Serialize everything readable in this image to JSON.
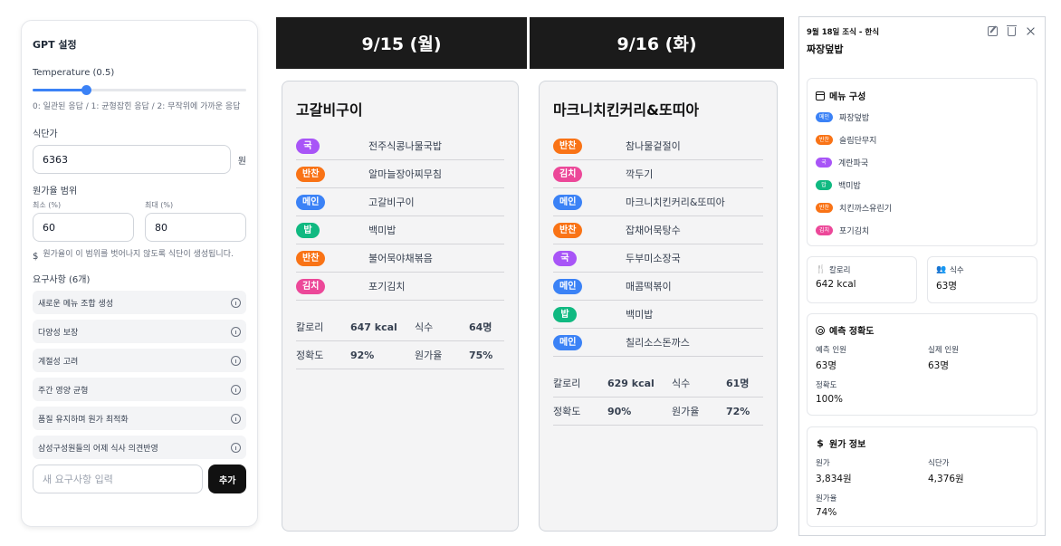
{
  "colors": {
    "rice": "#10b981",
    "soup": "#a855f7",
    "side": "#f97316",
    "main": "#3b82f6",
    "kimchi": "#ec4899"
  },
  "settings": {
    "title": "GPT 설정",
    "temperature_label": "Temperature (0.5)",
    "temperature_value": 0.5,
    "temperature_hint": "0: 일관된 응답 / 1: 균형잡힌 응답 / 2: 무작위에 가까운 응답",
    "meal_price_label": "식단가",
    "meal_price_value": "6363",
    "meal_price_unit": "원",
    "cost_range_label": "원가율 범위",
    "min_label": "최소 (%)",
    "min_value": "60",
    "max_label": "최대 (%)",
    "max_value": "80",
    "cost_note": "원가율이 이 범위를 벗어나지 않도록 식단이 생성됩니다.",
    "requirements_label": "요구사항 (6개)",
    "requirements": [
      "새로운 메뉴 조합 생성",
      "다양성 보장",
      "계절성 고려",
      "주간 영양 균형",
      "품질 유지하며 원가 최적화",
      "삼성구성원들의 어제 식사 의견반영"
    ],
    "new_requirement_placeholder": "새 요구사항 입력",
    "add_button": "추가"
  },
  "days": [
    {
      "header": "9/15 (월)",
      "title": "고갈비구이",
      "dishes": [
        {
          "tag": "국",
          "type": "soup",
          "name": "전주식콩나물국밥"
        },
        {
          "tag": "반찬",
          "type": "side",
          "name": "알마늘장아찌무침"
        },
        {
          "tag": "메인",
          "type": "main",
          "name": "고갈비구이"
        },
        {
          "tag": "밥",
          "type": "rice",
          "name": "백미밥"
        },
        {
          "tag": "반찬",
          "type": "side",
          "name": "불어묵야채볶음"
        },
        {
          "tag": "김치",
          "type": "kimchi",
          "name": "포기김치"
        }
      ],
      "stats": {
        "calorie_label": "칼로리",
        "calorie": "647 kcal",
        "count_label": "식수",
        "count": "64명",
        "accuracy_label": "정확도",
        "accuracy": "92%",
        "cost_label": "원가율",
        "cost": "75%"
      }
    },
    {
      "header": "9/16 (화)",
      "title": "마크니치킨커리&또띠아",
      "dishes": [
        {
          "tag": "반찬",
          "type": "side",
          "name": "참나물겉절이"
        },
        {
          "tag": "김치",
          "type": "kimchi",
          "name": "깍두기"
        },
        {
          "tag": "메인",
          "type": "main",
          "name": "마크니치킨커리&또띠아"
        },
        {
          "tag": "반찬",
          "type": "side",
          "name": "잡채어묵탕수"
        },
        {
          "tag": "국",
          "type": "soup",
          "name": "두부미소장국"
        },
        {
          "tag": "메인",
          "type": "main",
          "name": "매콤떡볶이"
        },
        {
          "tag": "밥",
          "type": "rice",
          "name": "백미밥"
        },
        {
          "tag": "메인",
          "type": "main",
          "name": "칠리소스돈까스"
        }
      ],
      "stats": {
        "calorie_label": "칼로리",
        "calorie": "629 kcal",
        "count_label": "식수",
        "count": "61명",
        "accuracy_label": "정확도",
        "accuracy": "90%",
        "cost_label": "원가율",
        "cost": "72%"
      }
    }
  ],
  "detail": {
    "meta": "9월 18일 조식 - 한식",
    "title": "짜장덮밥",
    "menu_section": "메뉴 구성",
    "menu": [
      {
        "tag": "메인",
        "type": "main",
        "name": "짜장덮밥"
      },
      {
        "tag": "반찬",
        "type": "side",
        "name": "슬림단무지"
      },
      {
        "tag": "국",
        "type": "soup",
        "name": "계란파국"
      },
      {
        "tag": "밥",
        "type": "rice",
        "name": "백미밥"
      },
      {
        "tag": "반찬",
        "type": "side",
        "name": "치킨까스유린기"
      },
      {
        "tag": "김치",
        "type": "kimchi",
        "name": "포기김치"
      }
    ],
    "calorie_label": "칼로리",
    "calorie": "642 kcal",
    "count_label": "식수",
    "count": "63명",
    "prediction_section": "예측 정확도",
    "predicted_label": "예측 인원",
    "predicted": "63명",
    "actual_label": "실제 인원",
    "actual": "63명",
    "accuracy_label": "정확도",
    "accuracy": "100%",
    "cost_section": "원가 정보",
    "cost_label": "원가",
    "cost": "3,834원",
    "meal_price_label": "식단가",
    "meal_price": "4,376원",
    "cost_rate_label": "원가율",
    "cost_rate": "74%"
  }
}
